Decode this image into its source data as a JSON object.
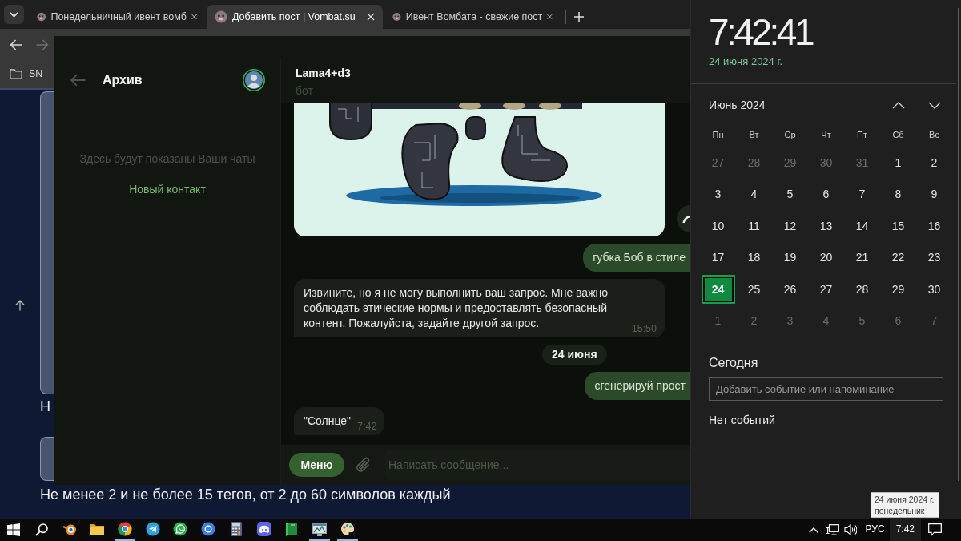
{
  "browser": {
    "tabs": [
      {
        "title": "Понедельничный ивент вомб",
        "selected": false
      },
      {
        "title": "Добавить пост | Vombat.su",
        "selected": true
      },
      {
        "title": "Ивент Вомбата - свежие пост",
        "selected": false
      }
    ],
    "toolbar": {
      "back_enabled": true,
      "forward_enabled": false
    },
    "bookmarks": [
      {
        "label": "SN"
      }
    ],
    "page": {
      "label": "Н",
      "hint": "Не менее 2 и не более 15 тегов, от 2 до 60 символов каждый"
    }
  },
  "messenger": {
    "sidebar": {
      "title": "Архив",
      "empty_text": "Здесь будут показаны Ваши чаты",
      "new_contact": "Новый контакт"
    },
    "chat": {
      "name": "Lama4+d3",
      "subtitle": "бот",
      "messages": [
        {
          "kind": "image"
        },
        {
          "kind": "outgoing",
          "text": "губка Боб в стиле"
        },
        {
          "kind": "incoming",
          "text": "Извините, но я не могу выполнить ваш запрос. Мне важно соблюдать этические нормы и предоставлять безопасный контент. Пожалуйста, задайте другой запрос.",
          "time": "15:50"
        },
        {
          "kind": "date",
          "text": "24 июня"
        },
        {
          "kind": "outgoing",
          "text": "сгенерируй прост"
        },
        {
          "kind": "incoming",
          "text": "\"Солнце\"",
          "time": "7:42"
        }
      ],
      "menu_button": "Меню",
      "composer_placeholder": "Написать сообщение..."
    }
  },
  "clock": {
    "time": "7:42:41",
    "date": "24 июня 2024 г."
  },
  "calendar": {
    "month": "Июнь 2024",
    "weekdays": [
      "Пн",
      "Вт",
      "Ср",
      "Чт",
      "Пт",
      "Сб",
      "Вс"
    ],
    "days": [
      {
        "day": "27",
        "current_month": false,
        "selected": false
      },
      {
        "day": "28",
        "current_month": false,
        "selected": false
      },
      {
        "day": "29",
        "current_month": false,
        "selected": false
      },
      {
        "day": "30",
        "current_month": false,
        "selected": false
      },
      {
        "day": "31",
        "current_month": false,
        "selected": false
      },
      {
        "day": "1",
        "current_month": true,
        "selected": false
      },
      {
        "day": "2",
        "current_month": true,
        "selected": false
      },
      {
        "day": "3",
        "current_month": true,
        "selected": false
      },
      {
        "day": "4",
        "current_month": true,
        "selected": false
      },
      {
        "day": "5",
        "current_month": true,
        "selected": false
      },
      {
        "day": "6",
        "current_month": true,
        "selected": false
      },
      {
        "day": "7",
        "current_month": true,
        "selected": false
      },
      {
        "day": "8",
        "current_month": true,
        "selected": false
      },
      {
        "day": "9",
        "current_month": true,
        "selected": false
      },
      {
        "day": "10",
        "current_month": true,
        "selected": false
      },
      {
        "day": "11",
        "current_month": true,
        "selected": false
      },
      {
        "day": "12",
        "current_month": true,
        "selected": false
      },
      {
        "day": "13",
        "current_month": true,
        "selected": false
      },
      {
        "day": "14",
        "current_month": true,
        "selected": false
      },
      {
        "day": "15",
        "current_month": true,
        "selected": false
      },
      {
        "day": "16",
        "current_month": true,
        "selected": false
      },
      {
        "day": "17",
        "current_month": true,
        "selected": false
      },
      {
        "day": "18",
        "current_month": true,
        "selected": false
      },
      {
        "day": "19",
        "current_month": true,
        "selected": false
      },
      {
        "day": "20",
        "current_month": true,
        "selected": false
      },
      {
        "day": "21",
        "current_month": true,
        "selected": false
      },
      {
        "day": "22",
        "current_month": true,
        "selected": false
      },
      {
        "day": "23",
        "current_month": true,
        "selected": false
      },
      {
        "day": "24",
        "current_month": true,
        "selected": true
      },
      {
        "day": "25",
        "current_month": true,
        "selected": false
      },
      {
        "day": "26",
        "current_month": true,
        "selected": false
      },
      {
        "day": "27",
        "current_month": true,
        "selected": false
      },
      {
        "day": "28",
        "current_month": true,
        "selected": false
      },
      {
        "day": "29",
        "current_month": true,
        "selected": false
      },
      {
        "day": "30",
        "current_month": true,
        "selected": false
      },
      {
        "day": "1",
        "current_month": false,
        "selected": false
      },
      {
        "day": "2",
        "current_month": false,
        "selected": false
      },
      {
        "day": "3",
        "current_month": false,
        "selected": false
      },
      {
        "day": "4",
        "current_month": false,
        "selected": false
      },
      {
        "day": "5",
        "current_month": false,
        "selected": false
      },
      {
        "day": "6",
        "current_month": false,
        "selected": false
      },
      {
        "day": "7",
        "current_month": false,
        "selected": false
      }
    ]
  },
  "agenda": {
    "title": "Сегодня",
    "placeholder": "Добавить событие или напоминание",
    "status": "Нет событий"
  },
  "tooltip": {
    "lines": [
      "24 июня 2024 г.",
      "понедельник"
    ]
  },
  "taskbar": {
    "apps": [
      {
        "kind": "start",
        "running": false
      },
      {
        "kind": "search",
        "running": false
      },
      {
        "kind": "orbit",
        "running": false
      },
      {
        "kind": "folder",
        "running": false
      },
      {
        "kind": "segmented-circle",
        "running": true
      },
      {
        "kind": "paper-plane",
        "running": false
      },
      {
        "kind": "phone-bubble",
        "running": false
      },
      {
        "kind": "ring",
        "running": false
      },
      {
        "kind": "calculator",
        "running": false
      },
      {
        "kind": "gamepad",
        "running": false
      },
      {
        "kind": "book",
        "running": false
      },
      {
        "kind": "chart-window",
        "running": true
      },
      {
        "kind": "palette",
        "running": true
      }
    ],
    "tray": {
      "language": "РУС",
      "time": "7:42"
    }
  }
}
